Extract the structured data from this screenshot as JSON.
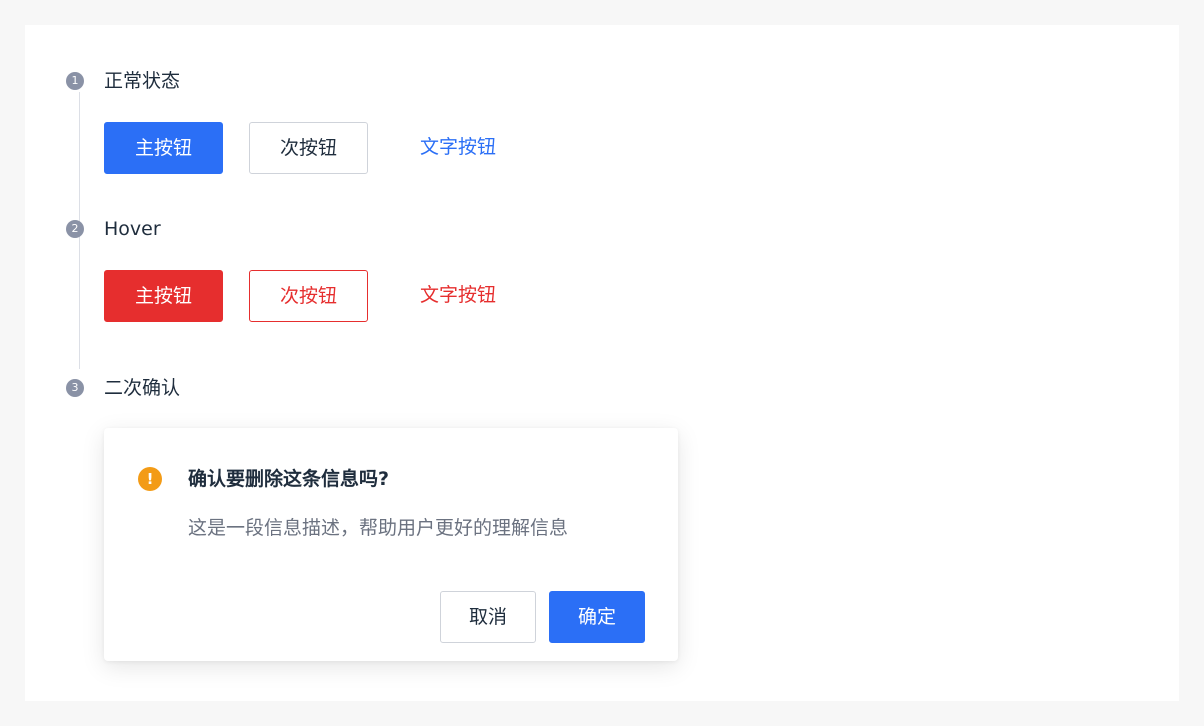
{
  "steps": [
    {
      "number": "1",
      "title": "正常状态"
    },
    {
      "number": "2",
      "title": "Hover"
    },
    {
      "number": "3",
      "title": "二次确认"
    }
  ],
  "normal": {
    "primary_label": "主按钮",
    "secondary_label": "次按钮",
    "text_label": "文字按钮"
  },
  "hover": {
    "primary_label": "主按钮",
    "secondary_label": "次按钮",
    "text_label": "文字按钮"
  },
  "dialog": {
    "icon_symbol": "!",
    "title": "确认要删除这条信息吗?",
    "description": "这是一段信息描述，帮助用户更好的理解信息",
    "cancel_label": "取消",
    "confirm_label": "确定"
  },
  "colors": {
    "primary": "#2b6ff6",
    "danger": "#e62e2e",
    "warning": "#f39b16",
    "step_dot": "#8a92a6"
  },
  "icons": {
    "step_marker": "numbered-circle-icon",
    "warning": "exclamation-circle-icon"
  }
}
